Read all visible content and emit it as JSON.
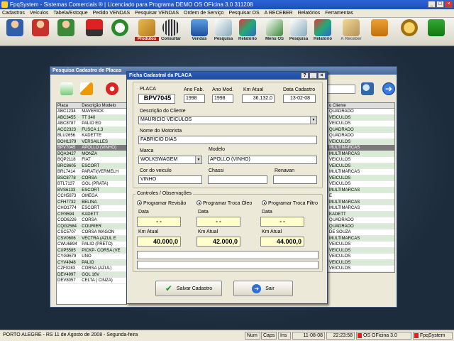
{
  "app": {
    "title": "FpqSystem - Sistemas Comerciais ® | Licenciado para Programa DEMO OS OFicina 3.0 311208"
  },
  "menu": [
    "Cadastros",
    "Veículos",
    "Tabela/Estoque",
    "Pedido VENDAS",
    "Pesquisar VENDAS",
    "Ordem de Serviço",
    "Pesquisar OS",
    "A RECEBER",
    "Relatórios",
    "Ferramentas"
  ],
  "toolbar": {
    "produtos": "Produtos",
    "consultar": "Consultar",
    "vendas": "Vendas",
    "pesquisa1": "Pesquisa",
    "relatorio1": "Relatório",
    "menu_os": "Menu OS",
    "pesquisa2": "Pesquisa",
    "relatorio2": "Relatório",
    "a_receber": "A Receber"
  },
  "colors": {
    "titlebar": "#1f4fb8",
    "row_alt": "#d9ead6",
    "highlight": "#ffffcc"
  },
  "search_window": {
    "title": "Pesquisa Cadastro de Placas",
    "col_placa": "Placa",
    "col_desc": "Descrição Modelo",
    "col_cliente": "o Cliente",
    "rows": [
      [
        "ABC1234",
        "MAVERICK"
      ],
      [
        "ABC3455",
        "TT 340"
      ],
      [
        "ABC8787",
        "PALIO ED"
      ],
      [
        "ACC2323",
        "FUSCA 1.3"
      ],
      [
        "BLU2656",
        "KADETTE"
      ],
      [
        "BOH1379",
        "VERSAILLES"
      ],
      [
        "BPV7045",
        "APOLLO (VINHO)"
      ],
      [
        "BQA3427",
        "MONZA"
      ],
      [
        "BQP2118",
        "FIAT"
      ],
      [
        "BRC8605",
        "ESCORT"
      ],
      [
        "BRL7414",
        "PARATI(VERMELH"
      ],
      [
        "BSC8778",
        "CORSA"
      ],
      [
        "BTL7137",
        "GOL (PRATA)"
      ],
      [
        "BVS6133",
        "ESCORT"
      ],
      [
        "CCH5873",
        "OMEGA"
      ],
      [
        "CFH7732",
        "BELINA"
      ],
      [
        "CHO1774",
        "ESCORT"
      ],
      [
        "CIY8594",
        "KADETT"
      ],
      [
        "COD6226",
        "CORSA"
      ],
      [
        "CQG2584",
        "COURIER"
      ],
      [
        "CSC5707",
        "CORSA  WAGON"
      ],
      [
        "CSV0606",
        "VECTRA (AZUL  E"
      ],
      [
        "CWU6894",
        "PALIO (PRETO)"
      ],
      [
        "CXP5585",
        "PICKP- CORSA (VE"
      ],
      [
        "CYG9679",
        "UNO"
      ],
      [
        "CYV4948",
        "PALIO"
      ],
      [
        "CZF0283",
        "CORSA (AZUL)"
      ],
      [
        "DEV4997",
        "GOL 16V"
      ],
      [
        "DEV8057",
        "CELTA ( CINZA)"
      ]
    ],
    "clientes": [
      "QUADRADO",
      "VEICULOS",
      "VEICULOS",
      "QUADRADO",
      "QUADRADO",
      "VEICULOS",
      "MULTIMARCAS",
      "MULTIMARCAS",
      "VEICULOS",
      "VEICULOS",
      "MULTIMARCAS",
      "VEICULOS",
      "VEICULOS",
      "MULTIMARCAS",
      "E",
      "MULTIMARCAS",
      "MULTIMARCAS",
      "KADETT",
      "QUADRADO",
      "QUADRADO",
      "DE SOUZA",
      "MULTIMARCAS",
      "VEICULOS",
      "VEICULOS",
      "VEICULOS",
      "VEICULOS",
      "VEICULOS",
      "CARLOS",
      "MULTIMARCAS"
    ]
  },
  "dialog": {
    "title": "Ficha Cadastral da PLACA",
    "placa_label": "PLACA",
    "placa": "BPV7045",
    "ano_fab_label": "Ano Fab.",
    "ano_fab": "1998",
    "ano_mod_label": "Ano Mod.",
    "ano_mod": "1998",
    "km_label": "Km Atual",
    "km": "36.132,0",
    "data_label": "Data Cadastro",
    "data": "13-02-08",
    "cliente_label": "Descrição do Cliente",
    "cliente": "MAURICIO VEICULOS",
    "motorista_label": "Nome do Motorista",
    "motorista": "FABRICIO DIAS",
    "marca_label": "Marca",
    "marca": "WOLKSWAGEM",
    "modelo_label": "Modelo",
    "modelo": "APOLLO (VINHO)",
    "cor_label": "Cor do veiculo",
    "cor": "VINHO",
    "chassi_label": "Chassi",
    "chassi": "",
    "renavan_label": "Renavan",
    "renavan": "",
    "controles_label": "Controles / Observações",
    "radio1": "Programar Revisão",
    "radio2": "Programar Troca Óleo",
    "radio3": "Programar Troca Filtro",
    "data_small": "Data",
    "data_val": "- -",
    "km_small": "Km Atual",
    "km1": "40.000,0",
    "km2": "42.000,0",
    "km3": "44.000,0",
    "salvar": "Salvar Cadastro",
    "sair": "Sair"
  },
  "status": {
    "cidade": "PORTO ALEGRE - RS 11 de Agosto de 2008 - Segunda-feira",
    "num": "Num",
    "caps": "Caps",
    "ins": "Ins",
    "date": "11-08-08",
    "time": "22:23:58",
    "os": "OS OFicina 3.0",
    "brand": "FpqSystem"
  }
}
